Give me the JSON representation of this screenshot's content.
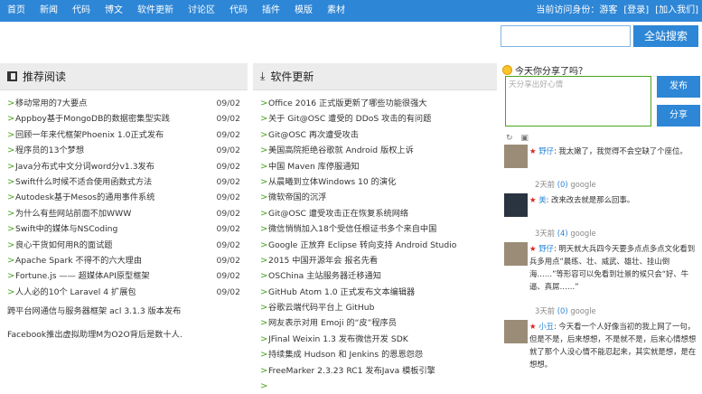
{
  "nav": {
    "items": [
      "首页",
      "新闻",
      "代码",
      "博文",
      "软件更新",
      "讨论区",
      "代码",
      "插件",
      "模版",
      "素材"
    ]
  },
  "nav_right": {
    "items": [
      "当前访问身份：游客",
      "[登录]",
      "[加入我们]"
    ]
  },
  "search": {
    "placeholder": "",
    "button": "全站搜索"
  },
  "left": {
    "title": "推荐阅读",
    "items": [
      {
        "title": "移动常用的7大要点",
        "date": "09/02"
      },
      {
        "title": "Appboy基于MongoDB的数据密集型实践",
        "date": "09/02"
      },
      {
        "title": "回顾一年来代框架Phoenix 1.0正式发布",
        "date": "09/02"
      },
      {
        "title": "程序员的13个梦想",
        "date": "09/02"
      },
      {
        "title": "Java分布式中文分词word分v1.3发布",
        "date": "09/02"
      },
      {
        "title": "Swift什么时候不适合使用函数式方法",
        "date": "09/02"
      },
      {
        "title": "Autodesk基于Mesos的通用事件系统",
        "date": "09/02"
      },
      {
        "title": "为什么有些网站前面不加WWW",
        "date": "09/02"
      },
      {
        "title": "Swift中的媒体与NSCoding",
        "date": "09/02"
      },
      {
        "title": "良心干货如何用R的面试题",
        "date": "09/02"
      },
      {
        "title": "Apache Spark 不得不的六大理由",
        "date": "09/02"
      },
      {
        "title": "Fortune.js —— 超媒体API原型框架",
        "date": "09/02"
      },
      {
        "title": "人人必的10个 Laravel 4 扩展包",
        "date": "09/02"
      },
      {
        "title": "跨平台网通信与服务器框架 acl 3.1.3 版本发布",
        "date": ""
      },
      {
        "title": "Facebook推出虚拟助理M为O2O背后是数十人.",
        "date": ""
      },
      {
        "title": "",
        "date": ""
      }
    ]
  },
  "mid": {
    "title": "软件更新",
    "items": [
      "Office 2016 正式版更新了哪些功能很强大",
      "关于 Git@OSC 遭受的 DDoS 攻击的有问题",
      "Git@OSC 再次遭受攻击",
      "美国高院拒绝谷歌就 Android 版权上诉",
      "中国 Maven 库停服通知",
      "从晨曦到立体Windows 10 的演化",
      "微软帝国的沉浮",
      "Git@OSC 遭受攻击正在恢复系统网络",
      "微信悄悄加入18个受信任根证书多个来自中国",
      "Google 正放弃 Eclipse 转向支持 Android Studio",
      "2015 中国开源年会 报名先看",
      "OSChina 主站服务器迁移通知",
      "GitHub Atom 1.0 正式发布文本编辑器",
      "谷歌云端代码平台上 GitHub",
      "网友表示对用 Emoji 的“皮”程序员",
      "JFinal Weixin 1.3 发布微信开发 SDK",
      "持续集成 Hudson 和 Jenkins 的恩恩怨怨",
      "FreeMarker 2.3.23 RC1 发布Java 模板引擎",
      ""
    ]
  },
  "tweet": {
    "title": "今天你分享了吗？",
    "placeholder": "天分享出好心情",
    "btn1": "发布",
    "btn2": "分享"
  },
  "tweets": [
    {
      "name": "野仔",
      "text": "我太嫩了，我觉得不会空缺了个座位。",
      "meta_time": "2天前",
      "meta_count": "(0)",
      "meta_src": "google"
    },
    {
      "name": "美",
      "text": "改来改去就是那么回事。",
      "meta_time": "3天前",
      "meta_count": "(4)",
      "meta_src": "google"
    },
    {
      "name": "野仔",
      "text": "明天就大兵四今天要多点点多点文化看到兵多用点“晨练、壮、威武、雄壮、挂山倒海……”等形容可以免看到壮景的候只会“好、牛逼、真屌……”",
      "meta_time": "3天前",
      "meta_count": "(0)",
      "meta_src": "google"
    },
    {
      "name": "小丑",
      "text": "今天看一个人好像当初的我上网了一句，但是不是，后来想想，不是就不是，后来心情想想就了那个人没心情不能忍起来，其实就是想，是在想想。",
      "meta_time": "",
      "meta_count": "",
      "meta_src": ""
    }
  ],
  "colors": {
    "accent": "#2d86d6",
    "green": "#4aa51c"
  }
}
